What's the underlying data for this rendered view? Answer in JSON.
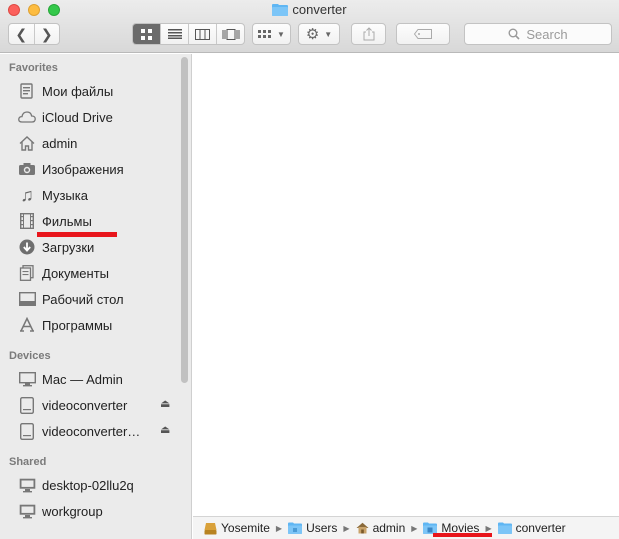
{
  "window": {
    "title": "converter"
  },
  "toolbar": {
    "back_icon": "chevron-left-icon",
    "forward_icon": "chevron-right-icon",
    "views": [
      "icon-view-icon",
      "list-view-icon",
      "column-view-icon",
      "coverflow-view-icon"
    ],
    "active_view": "icon-view-icon",
    "arrange_icon": "grid-arrange-icon",
    "action_icon": "gear-icon",
    "share_icon": "share-icon",
    "tag_icon": "tag-icon",
    "search_placeholder": "Search"
  },
  "sidebar": {
    "favorites": {
      "header": "Favorites",
      "items": [
        {
          "label": "Мои файлы",
          "icon": "all-files-icon"
        },
        {
          "label": "iCloud Drive",
          "icon": "cloud-icon"
        },
        {
          "label": "admin",
          "icon": "home-icon"
        },
        {
          "label": "Изображения",
          "icon": "camera-icon"
        },
        {
          "label": "Музыка",
          "icon": "music-note-icon"
        },
        {
          "label": "Фильмы",
          "icon": "film-icon"
        },
        {
          "label": "Загрузки",
          "icon": "download-icon"
        },
        {
          "label": "Документы",
          "icon": "document-icon"
        },
        {
          "label": "Рабочий стол",
          "icon": "desktop-icon"
        },
        {
          "label": "Программы",
          "icon": "applications-icon"
        }
      ]
    },
    "devices": {
      "header": "Devices",
      "items": [
        {
          "label": "Mac — Admin",
          "icon": "monitor-icon"
        },
        {
          "label": "videoconverter",
          "icon": "disk-icon",
          "eject": "⏏"
        },
        {
          "label": "videoconverter…",
          "icon": "disk-icon",
          "eject": "⏏"
        }
      ]
    },
    "shared": {
      "header": "Shared",
      "items": [
        {
          "label": "desktop-02llu2q",
          "icon": "network-computer-icon"
        },
        {
          "label": "workgroup",
          "icon": "network-computer-icon"
        }
      ]
    }
  },
  "pathbar": {
    "crumbs": [
      {
        "label": "Yosemite",
        "icon": "hard-drive-icon"
      },
      {
        "label": "Users",
        "icon": "folder-icon"
      },
      {
        "label": "admin",
        "icon": "home-icon"
      },
      {
        "label": "Movies",
        "icon": "movies-folder-icon"
      },
      {
        "label": "converter",
        "icon": "folder-icon"
      }
    ]
  },
  "annotations": {
    "highlight_color": "#e8151b"
  }
}
